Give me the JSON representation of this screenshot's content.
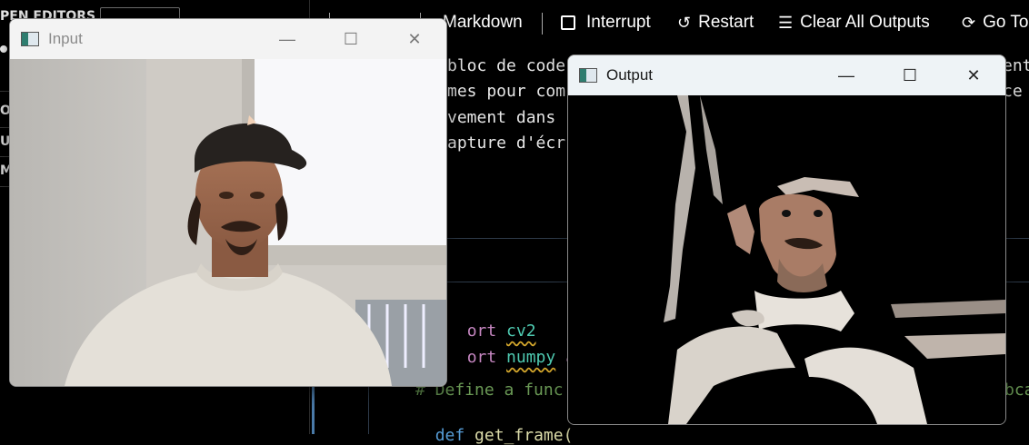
{
  "sidebar": {
    "open_editors": "PEN EDITORS",
    "rows": [
      "OO",
      "UT",
      "M"
    ]
  },
  "toolbar": {
    "items": [
      {
        "label": "Markdown",
        "icon": ""
      },
      {
        "label": "Interrupt",
        "icon": "stop-square-icon"
      },
      {
        "label": "Restart",
        "icon": "restart-icon"
      },
      {
        "label": "Clear All Outputs",
        "icon": "clear-outputs-icon"
      },
      {
        "label": "Go To",
        "icon": "refresh-icon"
      }
    ]
  },
  "markdown_cell": {
    "lines": [
      "bloc de code",
      "mes pour com",
      "vement dans",
      "apture d'écr"
    ],
    "right_fragments": [
      "ent",
      "ce"
    ]
  },
  "code_cell": {
    "line1_kw": "ort",
    "line1_mod": "cv2",
    "line2_kw": "ort",
    "line2_mod": "numpy",
    "line2_tail": "as",
    "comment": "# Define a func",
    "comment_tail": "bca",
    "def_kw": "def",
    "def_name": "get_frame",
    "def_paren": "("
  },
  "input_window": {
    "title": "Input",
    "buttons": {
      "minimize": "—",
      "maximize": "☐",
      "close": "✕"
    }
  },
  "output_window": {
    "title": "Output",
    "buttons": {
      "minimize": "—",
      "maximize": "☐",
      "close": "✕"
    }
  }
}
